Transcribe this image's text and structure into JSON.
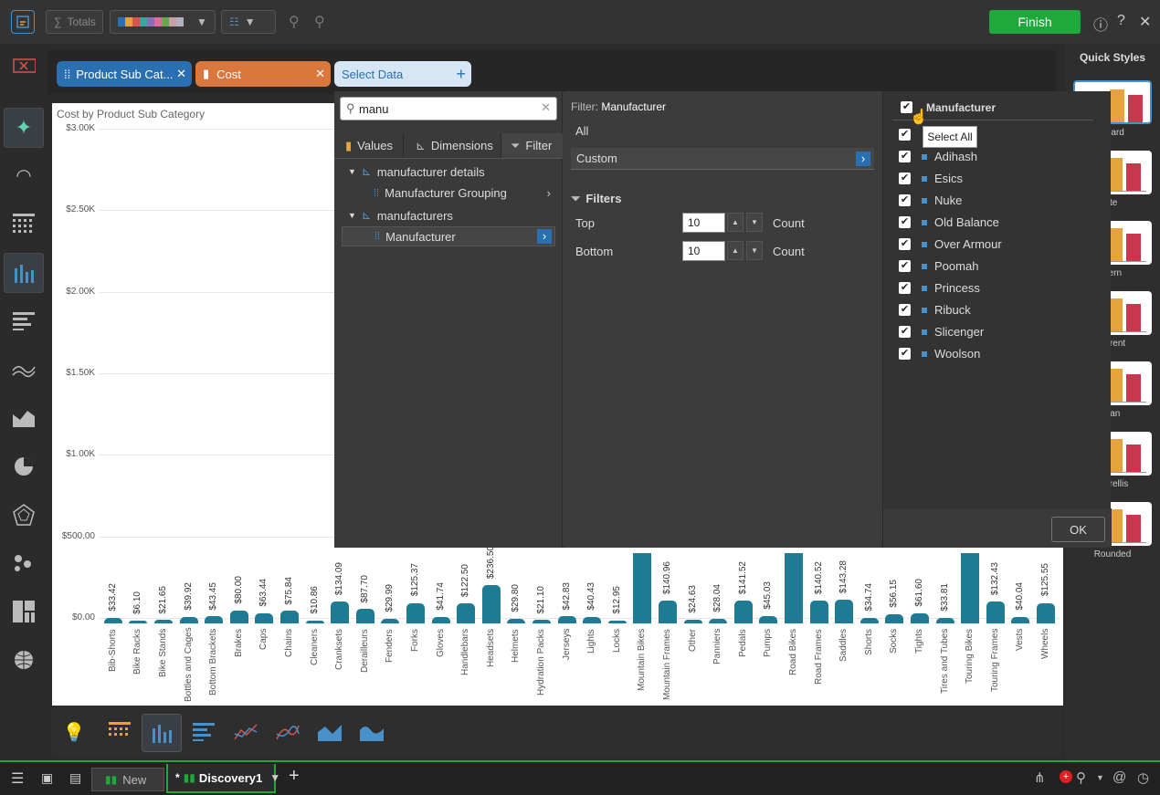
{
  "toolbar": {
    "totals_label": "Totals",
    "finish_label": "Finish"
  },
  "pills": [
    {
      "label": "Product Sub Cat...",
      "color": "#2b6fb3"
    },
    {
      "label": "Cost",
      "color": "#d9773c"
    },
    {
      "label": "Select Data"
    }
  ],
  "chart": {
    "title": "Cost by Product Sub Category"
  },
  "chart_data": {
    "type": "bar",
    "title": "Cost by Product Sub Category",
    "ylim": [
      0,
      3000
    ],
    "yticks": [
      "$3.00K",
      "$2.50K",
      "$2.00K",
      "$1.50K",
      "$1.00K",
      "$500.00",
      "$0.00"
    ],
    "categories": [
      "Bib-Shorts",
      "Bike Racks",
      "Bike Stands",
      "Bottles and Cages",
      "Bottom Brackets",
      "Brakes",
      "Caps",
      "Chains",
      "Cleaners",
      "Cranksets",
      "Derailleurs",
      "Fenders",
      "Forks",
      "Gloves",
      "Handlebars",
      "Headsets",
      "Helmets",
      "Hydration Packs",
      "Jerseys",
      "Lights",
      "Locks",
      "Mountain Bikes",
      "Mountain Frames",
      "Other",
      "Panniers",
      "Pedals",
      "Pumps",
      "Road Bikes",
      "Road Frames",
      "Saddles",
      "Shorts",
      "Socks",
      "Tights",
      "Tires and Tubes",
      "Touring Bikes",
      "Touring Frames",
      "Vests",
      "Wheels"
    ],
    "values": [
      33.42,
      6.1,
      21.65,
      39.92,
      43.45,
      80.0,
      63.44,
      75.84,
      10.86,
      134.09,
      87.7,
      29.99,
      125.37,
      41.74,
      122.5,
      236.5,
      29.8,
      21.1,
      42.83,
      40.43,
      12.95,
      null,
      140.96,
      24.63,
      28.04,
      141.52,
      45.03,
      null,
      140.52,
      143.28,
      34.74,
      56.15,
      61.6,
      33.81,
      null,
      132.43,
      40.04,
      125.55
    ],
    "value_labels": [
      "$33.42",
      "$6.10",
      "$21.65",
      "$39.92",
      "$43.45",
      "$80.00",
      "$63.44",
      "$75.84",
      "$10.86",
      "$134.09",
      "$87.70",
      "$29.99",
      "$125.37",
      "$41.74",
      "$122.50",
      "$236.50",
      "$29.80",
      "$21.10",
      "$42.83",
      "$40.43",
      "$12.95",
      "",
      "$140.96",
      "$24.63",
      "$28.04",
      "$141.52",
      "$45.03",
      "",
      "$140.52",
      "$143.28",
      "$34.74",
      "$56.15",
      "$61.60",
      "$33.81",
      "",
      "$132.43",
      "$40.04",
      "$125.55"
    ],
    "grid": true
  },
  "filter": {
    "search_value": "manu",
    "tabs": [
      "Values",
      "Dimensions",
      "Filter"
    ],
    "tree": {
      "group1": "manufacturer details",
      "item1": "Manufacturer Grouping",
      "group2": "manufacturers",
      "item2": "Manufacturer"
    },
    "heading_prefix": "Filter:",
    "heading_value": "Manufacturer",
    "all_label": "All",
    "custom_label": "Custom",
    "filters_label": "Filters",
    "top_label": "Top",
    "top_value": "10",
    "bottom_label": "Bottom",
    "bottom_value": "10",
    "count_label": "Count",
    "list_header": "Manufacturer",
    "tooltip": "Select All",
    "items": [
      "Adihash",
      "Esics",
      "Nuke",
      "Old Balance",
      "Over Armour",
      "Poomah",
      "Princess",
      "Ribuck",
      "Slicenger",
      "Woolson"
    ],
    "ok_label": "OK"
  },
  "quick_styles": {
    "title": "Quick Styles",
    "labels": [
      "ndard",
      "ite",
      "dern",
      "parent",
      "ean",
      "n Trellis",
      "Rounded"
    ]
  },
  "status": {
    "new_label": "New",
    "doc_label": "Discovery1",
    "doc_prefix": "*"
  }
}
